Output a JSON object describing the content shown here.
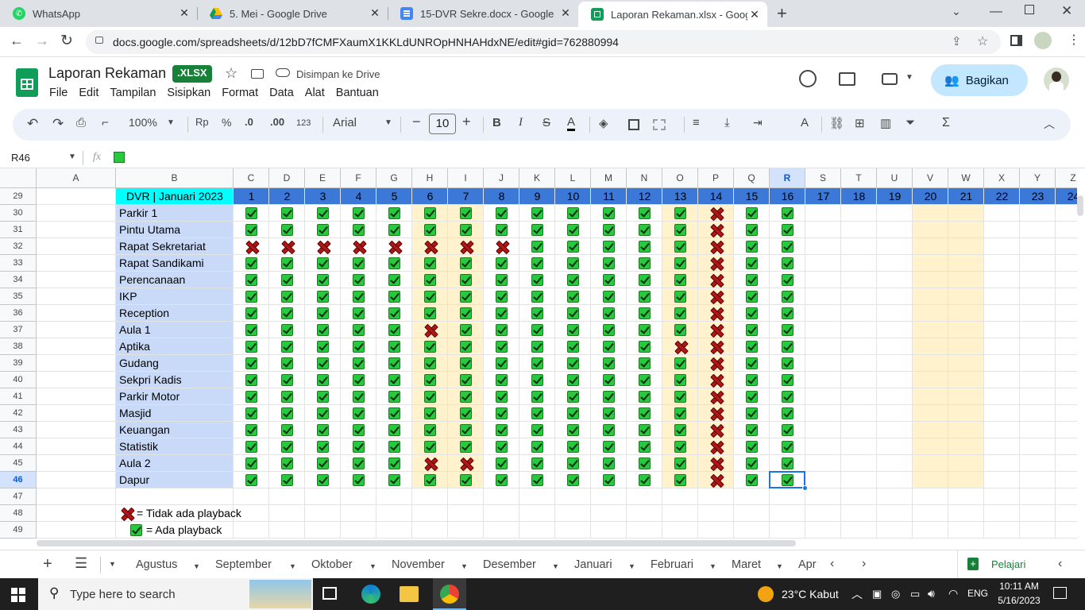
{
  "browser": {
    "tabs": [
      {
        "title": "WhatsApp",
        "icon": "whatsapp-icon",
        "color": "#25d366"
      },
      {
        "title": "5. Mei - Google Drive",
        "icon": "drive-icon",
        "color": "#fbbc04"
      },
      {
        "title": "15-DVR Sekre.docx - Google Dok",
        "icon": "docs-icon",
        "color": "#4285f4"
      },
      {
        "title": "Laporan Rekaman.xlsx - Google S",
        "icon": "sheets-icon",
        "color": "#0f9d58"
      }
    ],
    "url": "docs.google.com/spreadsheets/d/12bD7fCMFXaumX1KKLdUNROpHNHAHdxNE/edit#gid=762880994"
  },
  "doc": {
    "title": "Laporan Rekaman",
    "badge": ".XLSX",
    "saved_status": "Disimpan ke Drive",
    "menu": [
      "File",
      "Edit",
      "Tampilan",
      "Sisipkan",
      "Format",
      "Data",
      "Alat",
      "Bantuan"
    ],
    "share_label": "Bagikan"
  },
  "toolbar": {
    "zoom": "100%",
    "currency": "Rp",
    "percent": "%",
    "dec_less": ".0",
    "dec_more": ".00",
    "format_123": "123",
    "font": "Arial",
    "font_size": "10"
  },
  "formula_bar": {
    "cell_ref": "R46",
    "fx": "fx"
  },
  "sheet": {
    "columns": [
      "A",
      "B",
      "C",
      "D",
      "E",
      "F",
      "G",
      "H",
      "I",
      "J",
      "K",
      "L",
      "M",
      "N",
      "O",
      "P",
      "Q",
      "R",
      "S",
      "T",
      "U",
      "V",
      "W",
      "X",
      "Y",
      "Z"
    ],
    "selected_column": "R",
    "row_numbers": [
      "29",
      "30",
      "31",
      "32",
      "33",
      "34",
      "35",
      "36",
      "37",
      "38",
      "39",
      "40",
      "41",
      "42",
      "43",
      "44",
      "45",
      "46",
      "47",
      "48",
      "49"
    ],
    "selected_row": "46",
    "header_title": "DVR | Januari 2023",
    "days": [
      "1",
      "2",
      "3",
      "4",
      "5",
      "6",
      "7",
      "8",
      "9",
      "10",
      "11",
      "12",
      "13",
      "14",
      "15",
      "16",
      "17",
      "18",
      "19",
      "20",
      "21",
      "22",
      "23",
      "24"
    ],
    "weekend_cols": [
      6,
      7,
      13,
      14,
      20,
      21
    ],
    "rows": [
      {
        "name": "Parkir 1",
        "status": "1111111111111011"
      },
      {
        "name": "Pintu Utama",
        "status": "1111111111111011"
      },
      {
        "name": "Rapat Sekretariat",
        "status": "0000000011111011"
      },
      {
        "name": "Rapat Sandikami",
        "status": "1111111111111011"
      },
      {
        "name": "Perencanaan",
        "status": "1111111111111011"
      },
      {
        "name": "IKP",
        "status": "1111111111111011"
      },
      {
        "name": "Reception",
        "status": "1111111111111011"
      },
      {
        "name": "Aula 1",
        "status": "1111101111111011"
      },
      {
        "name": "Aptika",
        "status": "1111111111110011"
      },
      {
        "name": "Gudang",
        "status": "1111111111111011"
      },
      {
        "name": "Sekpri Kadis",
        "status": "1111111111111011"
      },
      {
        "name": "Parkir Motor",
        "status": "1111111111111011"
      },
      {
        "name": "Masjid",
        "status": "1111111111111011"
      },
      {
        "name": "Keuangan",
        "status": "1111111111111011"
      },
      {
        "name": "Statistik",
        "status": "1111111111111011"
      },
      {
        "name": "Aula 2",
        "status": "1111100111111011"
      },
      {
        "name": "Dapur",
        "status": "1111111111111011"
      }
    ],
    "legend": {
      "no_playback": "= Tidak ada playback",
      "playback": "= Ada playback"
    }
  },
  "sheet_tabs": [
    "Agustus",
    "September",
    "Oktober",
    "November",
    "Desember",
    "Januari",
    "Februari",
    "Maret",
    "Apr"
  ],
  "explore_label": "Pelajari",
  "taskbar": {
    "search_placeholder": "Type here to search",
    "weather": "23°C  Kabut",
    "lang": "ENG",
    "time": "10:11 AM",
    "date": "5/16/2023"
  },
  "colors": {
    "header_blue": "#3c78d8",
    "label_blue": "#c9daf8",
    "weekend": "#fff2cc",
    "header_cyan": "#00ffff"
  }
}
